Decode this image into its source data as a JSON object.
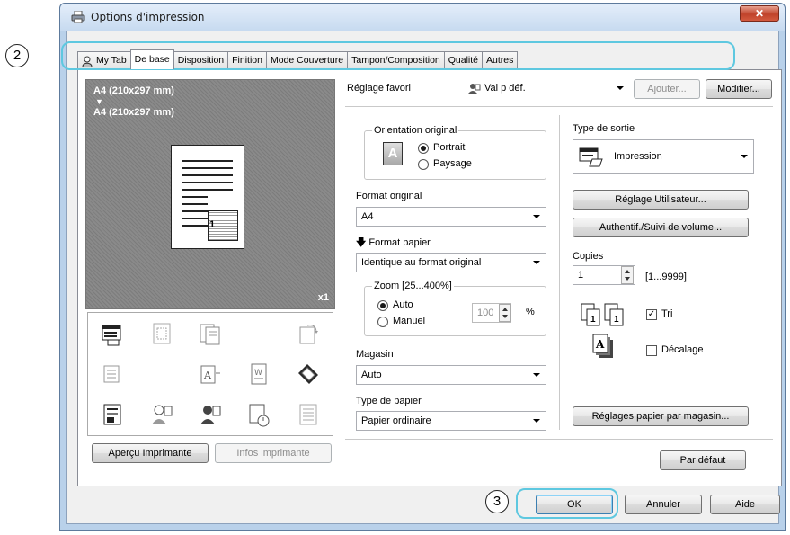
{
  "window": {
    "title": "Options d'impression",
    "close_glyph": "✕"
  },
  "tabs": [
    {
      "label": "My Tab",
      "icon": "user-icon"
    },
    {
      "label": "De base"
    },
    {
      "label": "Disposition"
    },
    {
      "label": "Finition"
    },
    {
      "label": "Mode Couverture"
    },
    {
      "label": "Tampon/Composition"
    },
    {
      "label": "Qualité"
    },
    {
      "label": "Autres"
    }
  ],
  "callouts": {
    "tabs": "2",
    "ok": "3"
  },
  "preview": {
    "original_size": "A4 (210x297 mm)",
    "arrow": "▼",
    "output_size": "A4 (210x297 mm)",
    "scale": "x1",
    "page_number": "1"
  },
  "left_buttons": {
    "printer_view": "Aperçu Imprimante",
    "printer_info": "Infos imprimante"
  },
  "favorite": {
    "label": "Réglage favori",
    "value": "Val p déf.",
    "add": "Ajouter...",
    "edit": "Modifier..."
  },
  "orientation": {
    "title": "Orientation original",
    "portrait": "Portrait",
    "landscape": "Paysage",
    "selected": "Portrait",
    "icon_letter": "A"
  },
  "original_size": {
    "label": "Format original",
    "value": "A4"
  },
  "paper_size": {
    "label": "Format papier",
    "value": "Identique au format original"
  },
  "zoom": {
    "title": "Zoom [25...400%]",
    "auto": "Auto",
    "manual": "Manuel",
    "value": "100",
    "unit": "%",
    "selected": "Auto"
  },
  "tray": {
    "label": "Magasin",
    "value": "Auto"
  },
  "paper_type": {
    "label": "Type de papier",
    "value": "Papier ordinaire"
  },
  "output": {
    "label": "Type de sortie",
    "value": "Impression"
  },
  "buttons": {
    "user_settings": "Réglage Utilisateur...",
    "authentication": "Authentif./Suivi de volume...",
    "paper_per_tray": "Réglages papier par magasin...",
    "default": "Par défaut",
    "ok": "OK",
    "cancel": "Annuler",
    "help": "Aide"
  },
  "copies": {
    "label": "Copies",
    "value": "1",
    "range": "[1...9999]"
  },
  "collate": {
    "label": "Tri",
    "checked": true,
    "glyph": "✓"
  },
  "offset": {
    "label": "Décalage",
    "checked": false
  }
}
